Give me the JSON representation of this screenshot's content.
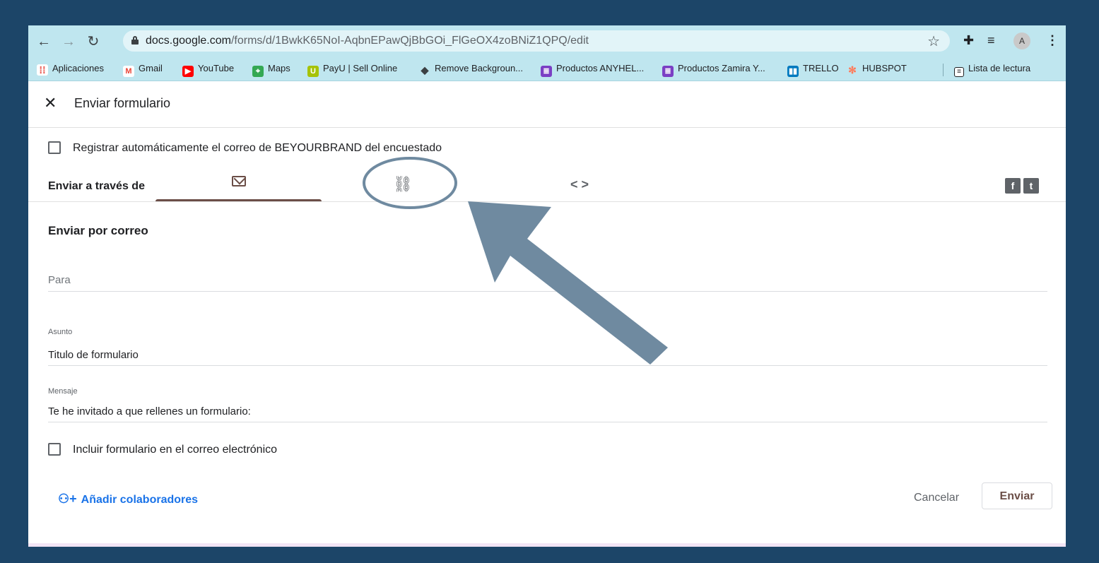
{
  "browser": {
    "url_domain": "docs.google.com",
    "url_path": "/forms/d/1BwkK65NoI-AqbnEPawQjBbGOi_FlGeOX4zoBNiZ1QPQ/edit",
    "profile_initial": "A"
  },
  "bookmarks": [
    {
      "label": "Aplicaciones",
      "icon": "apps-grid-icon",
      "color": "#e8453c"
    },
    {
      "label": "Gmail",
      "icon": "gmail-icon",
      "color": "#ea4335"
    },
    {
      "label": "YouTube",
      "icon": "youtube-icon",
      "color": "#ff0000"
    },
    {
      "label": "Maps",
      "icon": "maps-icon",
      "color": "#34a853"
    },
    {
      "label": "PayU | Sell Online",
      "icon": "payu-icon",
      "color": "#a6c307"
    },
    {
      "label": "Remove Backgroun...",
      "icon": "removebg-icon",
      "color": "#3c4043"
    },
    {
      "label": "Productos ANYHEL...",
      "icon": "sheets-icon",
      "color": "#7b3fc4"
    },
    {
      "label": "Productos Zamira Y...",
      "icon": "sheets-icon",
      "color": "#7b3fc4"
    },
    {
      "label": "TRELLO",
      "icon": "trello-icon",
      "color": "#0079bf"
    },
    {
      "label": "HUBSPOT",
      "icon": "hubspot-icon",
      "color": "#ff7a59"
    }
  ],
  "reading_list": "Lista de lectura",
  "dialog": {
    "title": "Enviar formulario",
    "collect_email_label": "Registrar automáticamente el correo de BEYOURBRAND del encuestado",
    "send_via_label": "Enviar a través de",
    "section_title": "Enviar por correo",
    "to_placeholder": "Para",
    "subject_label": "Asunto",
    "subject_value": "Titulo de formulario",
    "message_label": "Mensaje",
    "message_value": "Te he invitado a que rellenes un formulario:",
    "include_form_label": "Incluir formulario en el correo electrónico",
    "add_collaborators": "Añadir colaboradores",
    "cancel": "Cancelar",
    "send": "Enviar"
  },
  "colors": {
    "accent": "#6b4e47",
    "link": "#1a73e8",
    "background": "#1c4568",
    "annotation": "#6f8aa0"
  }
}
